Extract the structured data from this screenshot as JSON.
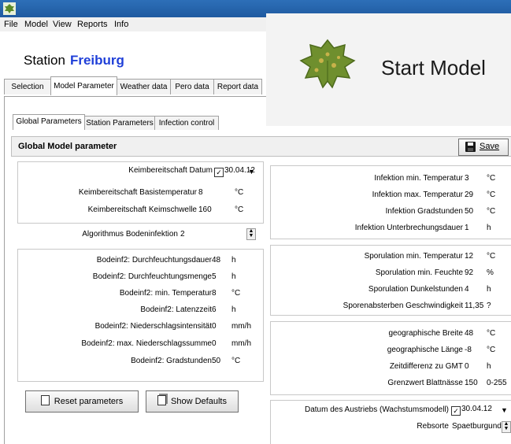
{
  "menu": [
    "File",
    "Model",
    "View",
    "Reports",
    "Info"
  ],
  "station": {
    "label": "Station",
    "name": "Freiburg"
  },
  "main_tabs": [
    "Selection",
    "Model Parameter",
    "Weather data",
    "Pero data",
    "Report data"
  ],
  "sub_tabs": [
    "Global Parameters",
    "Station Parameters",
    "Infection control"
  ],
  "header": {
    "title": "Global Model parameter",
    "save_label": "Save"
  },
  "popup": {
    "start_model": "Start Model"
  },
  "left_top": [
    {
      "label": "Keimbereitschaft Datum",
      "value": "30.04.12",
      "unit": ""
    },
    {
      "label": "Keimbereitschaft Basistemperatur",
      "value": "8",
      "unit": "°C"
    },
    {
      "label": "Keimbereitschaft Keimschwelle",
      "value": "160",
      "unit": "°C"
    }
  ],
  "algorithm": {
    "label": "Algorithmus Bodeninfektion",
    "value": "2"
  },
  "left_bottom": [
    {
      "label": "Bodeinf2: Durchfeuchtungsdauer",
      "value": "48",
      "unit": "h"
    },
    {
      "label": "Bodeinf2: Durchfeuchtungsmenge",
      "value": "5",
      "unit": "h"
    },
    {
      "label": "Bodeinf2: min. Temperatur",
      "value": "8",
      "unit": "°C"
    },
    {
      "label": "Bodeinf2: Latenzzeit",
      "value": "6",
      "unit": "h"
    },
    {
      "label": "Bodeinf2: Niederschlagsintensität",
      "value": "0",
      "unit": "mm/h"
    },
    {
      "label": "Bodeinf2: max. Niederschlagssumme",
      "value": "0",
      "unit": "mm/h"
    },
    {
      "label": "Bodeinf2: Gradstunden",
      "value": "50",
      "unit": "°C"
    }
  ],
  "buttons": {
    "reset": "Reset parameters",
    "defaults": "Show Defaults"
  },
  "right_infektion": [
    {
      "label": "Infektion min. Temperatur",
      "value": "3",
      "unit": "°C"
    },
    {
      "label": "Infektion max. Temperatur",
      "value": "29",
      "unit": "°C"
    },
    {
      "label": "Infektion Gradstunden",
      "value": "50",
      "unit": "°C"
    },
    {
      "label": "Infektion Unterbrechungsdauer",
      "value": "1",
      "unit": "h"
    }
  ],
  "right_sporulation": [
    {
      "label": "Sporulation min. Temperatur",
      "value": "12",
      "unit": "°C"
    },
    {
      "label": "Sporulation min. Feuchte",
      "value": "92",
      "unit": "%"
    },
    {
      "label": "Sporulation Dunkelstunden",
      "value": "4",
      "unit": "h"
    },
    {
      "label": "Sporenabsterben Geschwindigkeit",
      "value": "11,35",
      "unit": "?"
    }
  ],
  "right_geo": [
    {
      "label": "geographische Breite",
      "value": "48",
      "unit": "°C"
    },
    {
      "label": "geographische Länge",
      "value": "-8",
      "unit": "°C"
    },
    {
      "label": "Zeitdifferenz zu GMT",
      "value": "0",
      "unit": "h"
    },
    {
      "label": "Grenzwert Blattnässe",
      "value": "150",
      "unit": "0-255"
    }
  ],
  "austrieb": {
    "label": "Datum des Austriebs  (Wachstumsmodell)",
    "value": "30.04.12"
  },
  "rebsorte": {
    "label": "Rebsorte",
    "value": "Spaetburgund"
  },
  "colors": {
    "titlebar": "#2d6fb8",
    "station_name": "#1f3fd8"
  }
}
